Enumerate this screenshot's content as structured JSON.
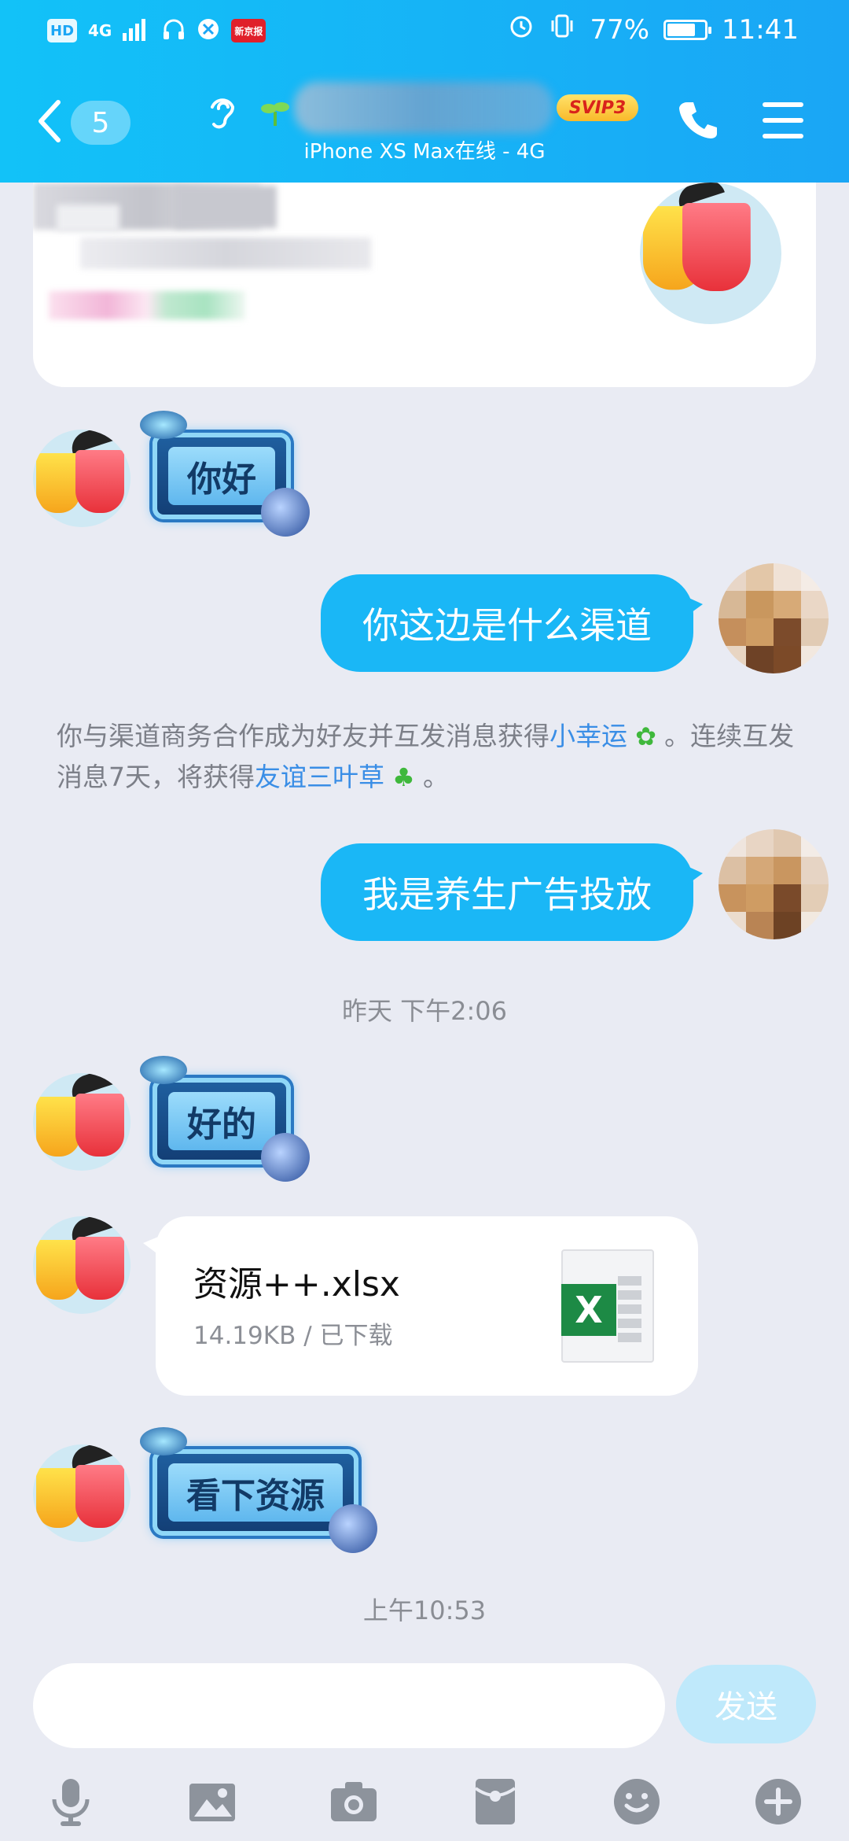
{
  "status_bar": {
    "left_icons": [
      "HD",
      "4G",
      "signal",
      "headset-icon",
      "browser-icon",
      "news-icon"
    ],
    "right": {
      "battery": "77%",
      "time": "11:41"
    }
  },
  "header": {
    "unread_count": "5",
    "svip_badge": "SVIP3",
    "subtitle": "iPhone XS Max在线 - 4G"
  },
  "messages": {
    "m1_sticker": "你好",
    "m2_me": "你这边是什么渠道",
    "system": {
      "part1": "你与渠道商务合作成为好友并互发消息获得",
      "link1": "小幸运",
      "part2": "。连续互发消息7天，将获得",
      "link2": "友谊三叶草",
      "part3": "。"
    },
    "m3_me": "我是养生广告投放",
    "time1": "昨天 下午2:06",
    "m4_sticker": "好的",
    "file": {
      "name": "资源++.xlsx",
      "meta": "14.19KB / 已下载",
      "icon_letter": "X"
    },
    "m5_sticker": "看下资源",
    "time2": "上午10:53"
  },
  "input_bar": {
    "placeholder": "",
    "send_label": "发送",
    "tools": [
      "mic-icon",
      "image-icon",
      "camera-icon",
      "red-packet-icon",
      "emoji-icon",
      "plus-icon"
    ]
  },
  "colors": {
    "accent": "#1ab7f6",
    "link": "#3a8ee6",
    "background": "#e9ebf3"
  }
}
